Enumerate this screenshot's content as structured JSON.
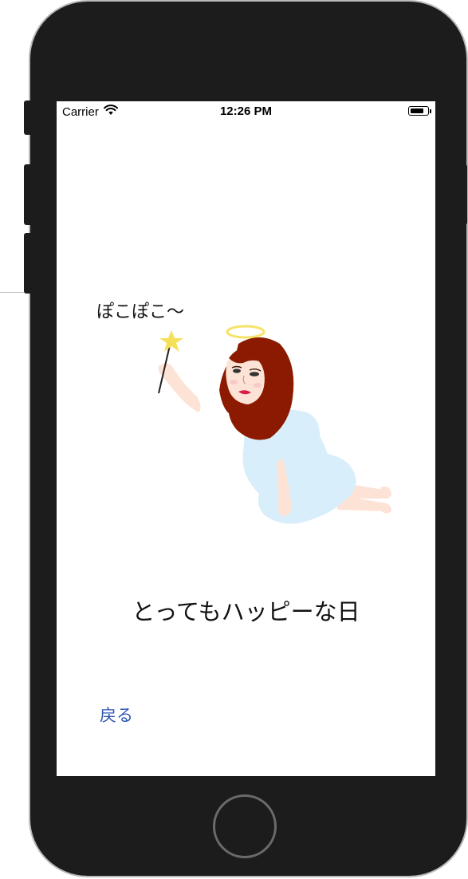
{
  "status_bar": {
    "carrier": "Carrier",
    "time": "12:26 PM",
    "battery_level": 0.8
  },
  "screen": {
    "sound_text": "ぽこぽこ〜",
    "message": "とってもハッピーな日",
    "back_label": "戻る"
  },
  "colors": {
    "device_body": "#1c1c1c",
    "link": "#2f56b5",
    "dress": "#d8eefa",
    "hair": "#8b1a00",
    "halo": "#f5e36a",
    "star": "#f6e05a",
    "skin": "#fde3d6"
  },
  "icons": [
    "wifi-icon",
    "battery-icon",
    "star-wand-icon",
    "halo-icon"
  ]
}
